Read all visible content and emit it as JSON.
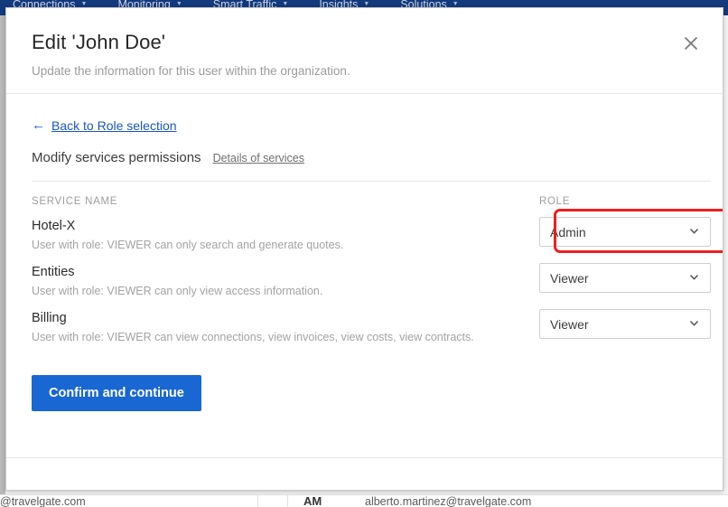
{
  "app": {
    "navbar": {
      "items": [
        {
          "label": "Connections",
          "icon": "chevron-down-icon"
        },
        {
          "label": "Monitoring",
          "icon": "chevron-down-icon"
        },
        {
          "label": "Smart Traffic",
          "icon": "chevron-down-icon"
        },
        {
          "label": "Insights",
          "icon": "chevron-down-icon"
        },
        {
          "label": "Solutions",
          "icon": "chevron-down-icon"
        }
      ]
    },
    "background_table_row": {
      "email_left": "@travelgate.com",
      "avatar_initials": "AM",
      "email_right": "alberto.martinez@travelgate.com"
    }
  },
  "dialog": {
    "title": "Edit 'John Doe'",
    "subtitle": "Update the information for this user within the organization.",
    "close_icon": "close-icon",
    "back_link": {
      "label": "Back to Role selection",
      "icon": "arrow-left-icon"
    },
    "section": {
      "heading": "Modify services permissions",
      "details_link": "Details of services"
    },
    "table": {
      "columns": [
        "SERVICE NAME",
        "ROLE"
      ],
      "rows": [
        {
          "service": "Hotel-X",
          "description": "User with role: VIEWER can only search and generate quotes.",
          "role": "Admin",
          "highlighted": true
        },
        {
          "service": "Entities",
          "description": "User with role: VIEWER can only view access information.",
          "role": "Viewer",
          "highlighted": false
        },
        {
          "service": "Billing",
          "description": "User with role: VIEWER can view connections, view invoices, view costs, view contracts.",
          "role": "Viewer",
          "highlighted": false
        }
      ]
    },
    "confirm_button": "Confirm and continue"
  },
  "colors": {
    "navbar": "#133a7c",
    "primary": "#1967d2",
    "link": "#1a56c4",
    "annotation": "#ee1d1d",
    "muted_text": "#a3a3a3"
  }
}
